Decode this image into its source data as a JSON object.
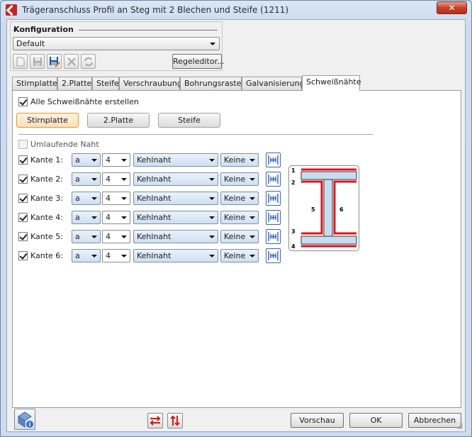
{
  "window": {
    "title": "Trägeranschluss Profil an Steg mit 2 Blechen und Steife (1211)",
    "close_symbol": "✕"
  },
  "config": {
    "legend": "Konfiguration",
    "selected": "Default",
    "regeleditor_label": "Regeleditor..."
  },
  "tabs": [
    "Stirnplatte",
    "2.Platte",
    "Steife",
    "Verschraubung",
    "Bohrungsraster",
    "Galvanisierung",
    "Schweißnähte"
  ],
  "active_tab": "Schweißnähte",
  "panel": {
    "alle_label": "Alle Schweißnähte erstellen",
    "alle_checked": true,
    "buttons": [
      "Stirnplatte",
      "2.Platte",
      "Steife"
    ],
    "active_button": "Stirnplatte",
    "umlaufende_label": "Umlaufende Naht",
    "umlaufende_checked": false,
    "rows": [
      {
        "label": "Kante 1:",
        "type": "a",
        "size": "4",
        "seam": "Kehlnaht",
        "extra": "Keine"
      },
      {
        "label": "Kante 2:",
        "type": "a",
        "size": "4",
        "seam": "Kehlnaht",
        "extra": "Keine"
      },
      {
        "label": "Kante 3:",
        "type": "a",
        "size": "4",
        "seam": "Kehlnaht",
        "extra": "Keine"
      },
      {
        "label": "Kante 4:",
        "type": "a",
        "size": "4",
        "seam": "Kehlnaht",
        "extra": "Keine"
      },
      {
        "label": "Kante 5:",
        "type": "a",
        "size": "4",
        "seam": "Kehlnaht",
        "extra": "Keine"
      },
      {
        "label": "Kante 6:",
        "type": "a",
        "size": "4",
        "seam": "Kehlnaht",
        "extra": "Keine"
      }
    ],
    "diagram_labels": [
      "1",
      "2",
      "3",
      "4",
      "5",
      "6"
    ]
  },
  "footer": {
    "vorschau": "Vorschau",
    "ok": "OK",
    "abbrechen": "Abbrechen"
  },
  "colors": {
    "weld_red": "#e0141b",
    "active_orange": "#e8922c",
    "steel_fill": "#c9dcef"
  }
}
